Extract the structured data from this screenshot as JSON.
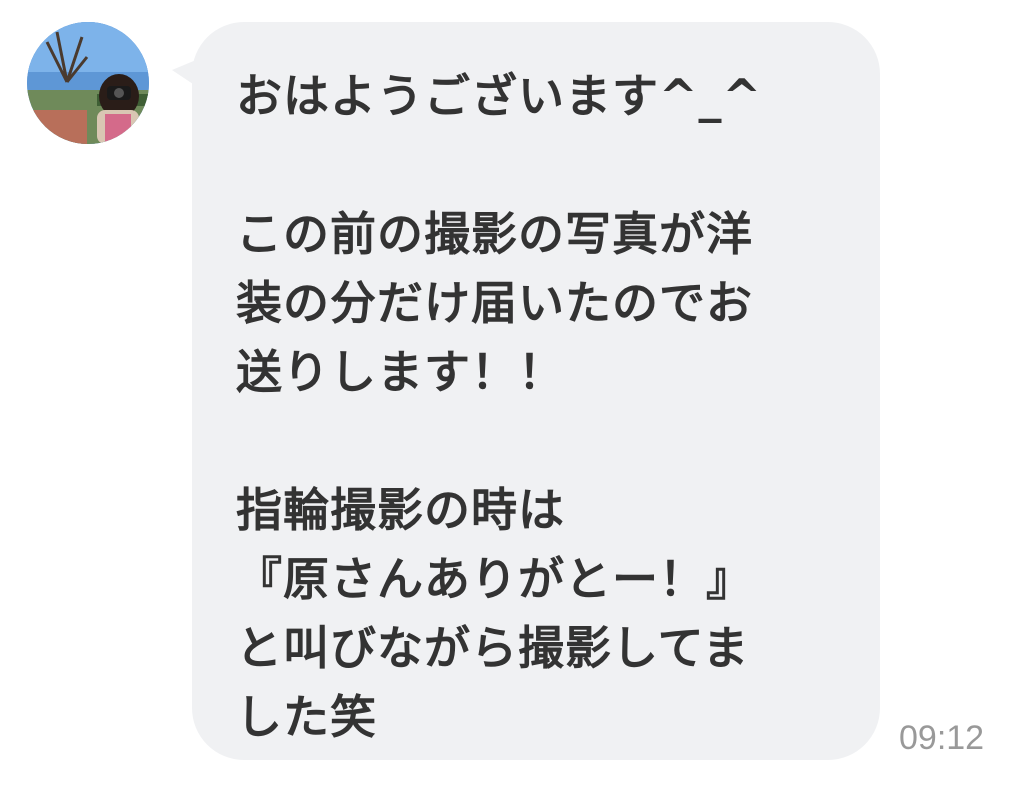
{
  "message": {
    "lines": [
      "おはようございます^_^",
      "",
      "この前の撮影の写真が洋",
      "装の分だけ届いたのでお",
      "送りします！！",
      "",
      "指輪撮影の時は",
      "『原さんありがとー！』",
      "と叫びながら撮影してま",
      "した笑"
    ],
    "timestamp": "09:12"
  },
  "sender": {
    "avatar_icon": "profile-photo"
  },
  "colors": {
    "bubble": "#f0f1f3",
    "text": "#333333",
    "timestamp": "#999999"
  }
}
